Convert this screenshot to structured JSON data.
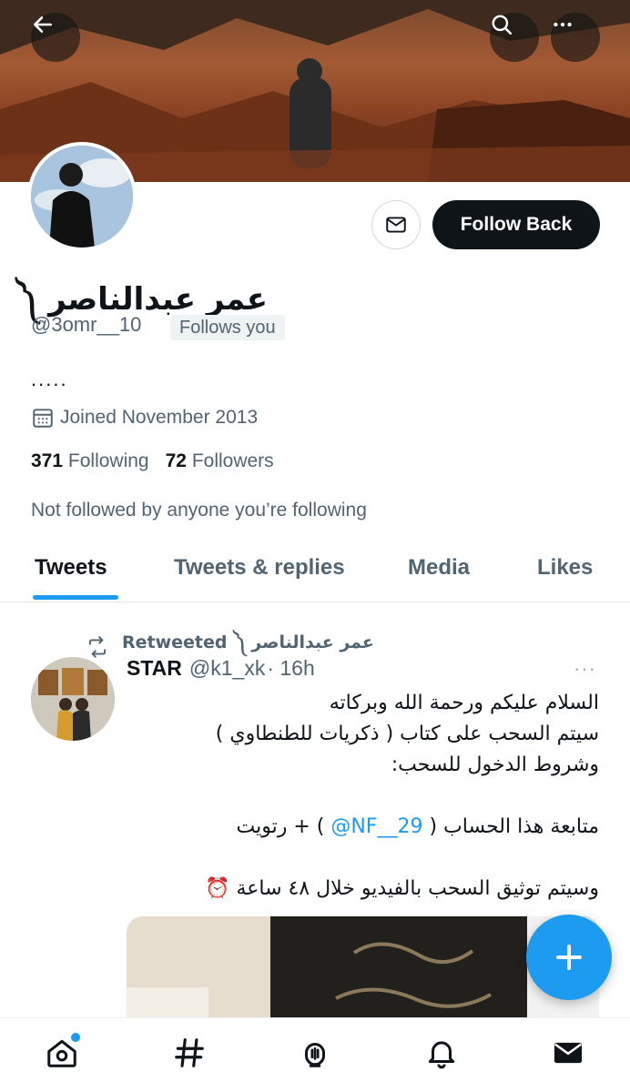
{
  "profile": {
    "display_name": "عمر عبدالناصر ༼",
    "handle": "@3omr__10",
    "follows_you_badge": "Follows you",
    "bio": ".....",
    "joined": "Joined November 2013",
    "following_count": "371",
    "following_label": "Following",
    "followers_count": "72",
    "followers_label": "Followers",
    "not_followed_text": "Not followed by anyone you’re following",
    "follow_button_label": "Follow Back"
  },
  "tabs": [
    {
      "label": "Tweets",
      "active": true
    },
    {
      "label": "Tweets & replies",
      "active": false
    },
    {
      "label": "Media",
      "active": false
    },
    {
      "label": "Likes",
      "active": false
    }
  ],
  "tweet": {
    "retweeted_by": "عمر عبدالناصر ༼ Retweeted",
    "author_name": "STAR",
    "author_handle": "@k1_xk",
    "time": "· 16h",
    "more": "···",
    "lines": [
      "السلام عليكم ورحمة الله وبركاته",
      "سيتم السحب على كتاب ( ذكريات للطنطاوي )",
      "وشروط الدخول للسحب:",
      "",
      "متابعة هذا الحساب (",
      "",
      "وسيتم توثيق السحب بالفيديو خلال ٤٨ ساعة ⏰"
    ],
    "mention": "@NF__29",
    "line5_suffix": ") + رتويت"
  },
  "colors": {
    "accent": "#1d9bf0",
    "text_primary": "#0f1419",
    "text_secondary": "#536471"
  },
  "icons": {
    "back": "arrow-left-icon",
    "search": "search-icon",
    "more": "more-icon",
    "message": "envelope-icon",
    "calendar": "calendar-icon",
    "retweet": "retweet-icon",
    "compose": "plus-icon",
    "nav": [
      "home-icon",
      "hashtag-icon",
      "spaces-icon",
      "bell-icon",
      "mail-icon"
    ]
  }
}
